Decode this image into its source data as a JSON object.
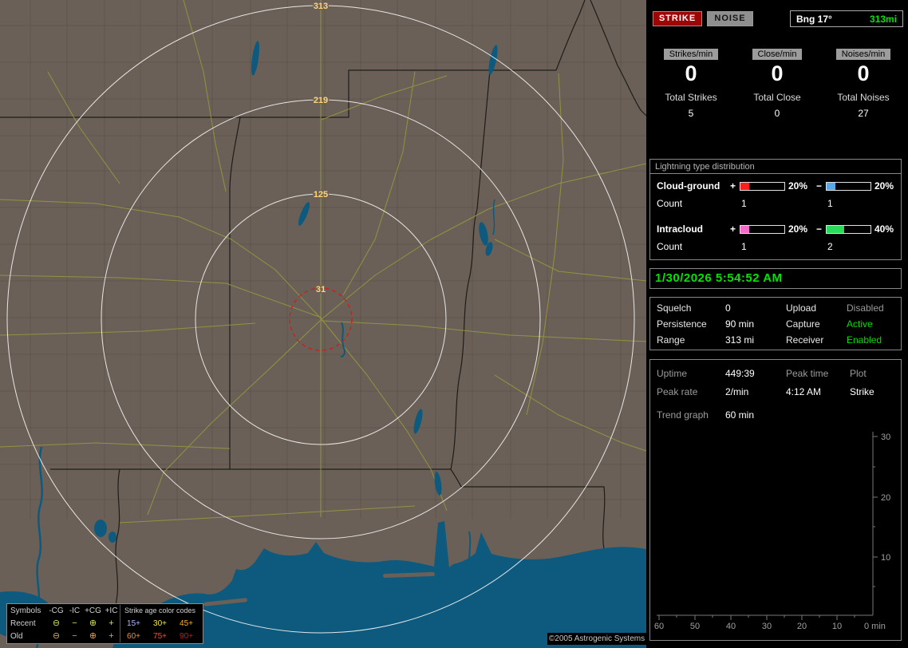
{
  "map": {
    "ring_labels": [
      "313",
      "219",
      "125",
      "31"
    ],
    "copyright": "©2005 Astrogenic Systems",
    "legend": {
      "symbols_header": "Symbols",
      "type_headers": [
        "-CG",
        "-IC",
        "+CG",
        "+IC"
      ],
      "age_header": "Strike age color codes",
      "symbols": [
        "⊖",
        "−",
        "⊕",
        "+"
      ],
      "rows": [
        {
          "label": "Recent",
          "symbol_color": "#d8e050",
          "ages": [
            "15+",
            "30+",
            "45+"
          ],
          "age_colors": [
            "#aab8ff",
            "#f2e44a",
            "#ffb02a"
          ]
        },
        {
          "label": "Old",
          "symbol_color": "#f0a030",
          "ages": [
            "60+",
            "75+",
            "90+"
          ],
          "age_colors": [
            "#ff8c1a",
            "#ff4a1a",
            "#e01010"
          ]
        }
      ]
    }
  },
  "panel": {
    "strike_button": "STRIKE",
    "noise_button": "NOISE",
    "bearing": "Bng 17°",
    "bearing_range": "313mi",
    "counters": [
      {
        "label": "Strikes/min",
        "rate": "0",
        "total_label": "Total Strikes",
        "total": "5"
      },
      {
        "label": "Close/min",
        "rate": "0",
        "total_label": "Total Close",
        "total": "0"
      },
      {
        "label": "Noises/min",
        "rate": "0",
        "total_label": "Total Noises",
        "total": "27"
      }
    ],
    "distribution": {
      "title": "Lightning type distribution",
      "count_label": "Count",
      "rows": [
        {
          "label": "Cloud-ground",
          "plus_sign": "+",
          "minus_sign": "−",
          "plus_pct": "20%",
          "minus_pct": "20%",
          "plus_count": "1",
          "minus_count": "1",
          "plus_color": "#ff1e1e",
          "minus_color": "#58a8e8"
        },
        {
          "label": "Intracloud",
          "plus_sign": "+",
          "minus_sign": "−",
          "plus_pct": "20%",
          "minus_pct": "40%",
          "plus_count": "1",
          "minus_count": "2",
          "plus_color": "#f06ec8",
          "minus_color": "#28dc5a"
        }
      ]
    },
    "clock": "1/30/2026 5:54:52 AM",
    "settings": {
      "rows": [
        {
          "l1": "Squelch",
          "v1": "0",
          "l2": "Upload",
          "v2": "Disabled",
          "v2_color": "#9a9a9a"
        },
        {
          "l1": "Persistence",
          "v1": "90 min",
          "l2": "Capture",
          "v2": "Active",
          "v2_color": "#00dc00"
        },
        {
          "l1": "Range",
          "v1": "313 mi",
          "l2": "Receiver",
          "v2": "Enabled",
          "v2_color": "#00dc00"
        }
      ]
    },
    "stats": {
      "uptime_label": "Uptime",
      "uptime": "449:39",
      "peak_time_label": "Peak time",
      "plot_label": "Plot",
      "peak_rate_label": "Peak rate",
      "peak_rate": "2/min",
      "peak_time": "4:12 AM",
      "plot_type": "Strike",
      "trend_label": "Trend graph",
      "trend_window": "60 min"
    },
    "trend_axes": {
      "y_ticks": [
        "30",
        "20",
        "10"
      ],
      "x_ticks": [
        "60",
        "50",
        "40",
        "30",
        "20",
        "10"
      ],
      "origin": "0 min"
    }
  }
}
